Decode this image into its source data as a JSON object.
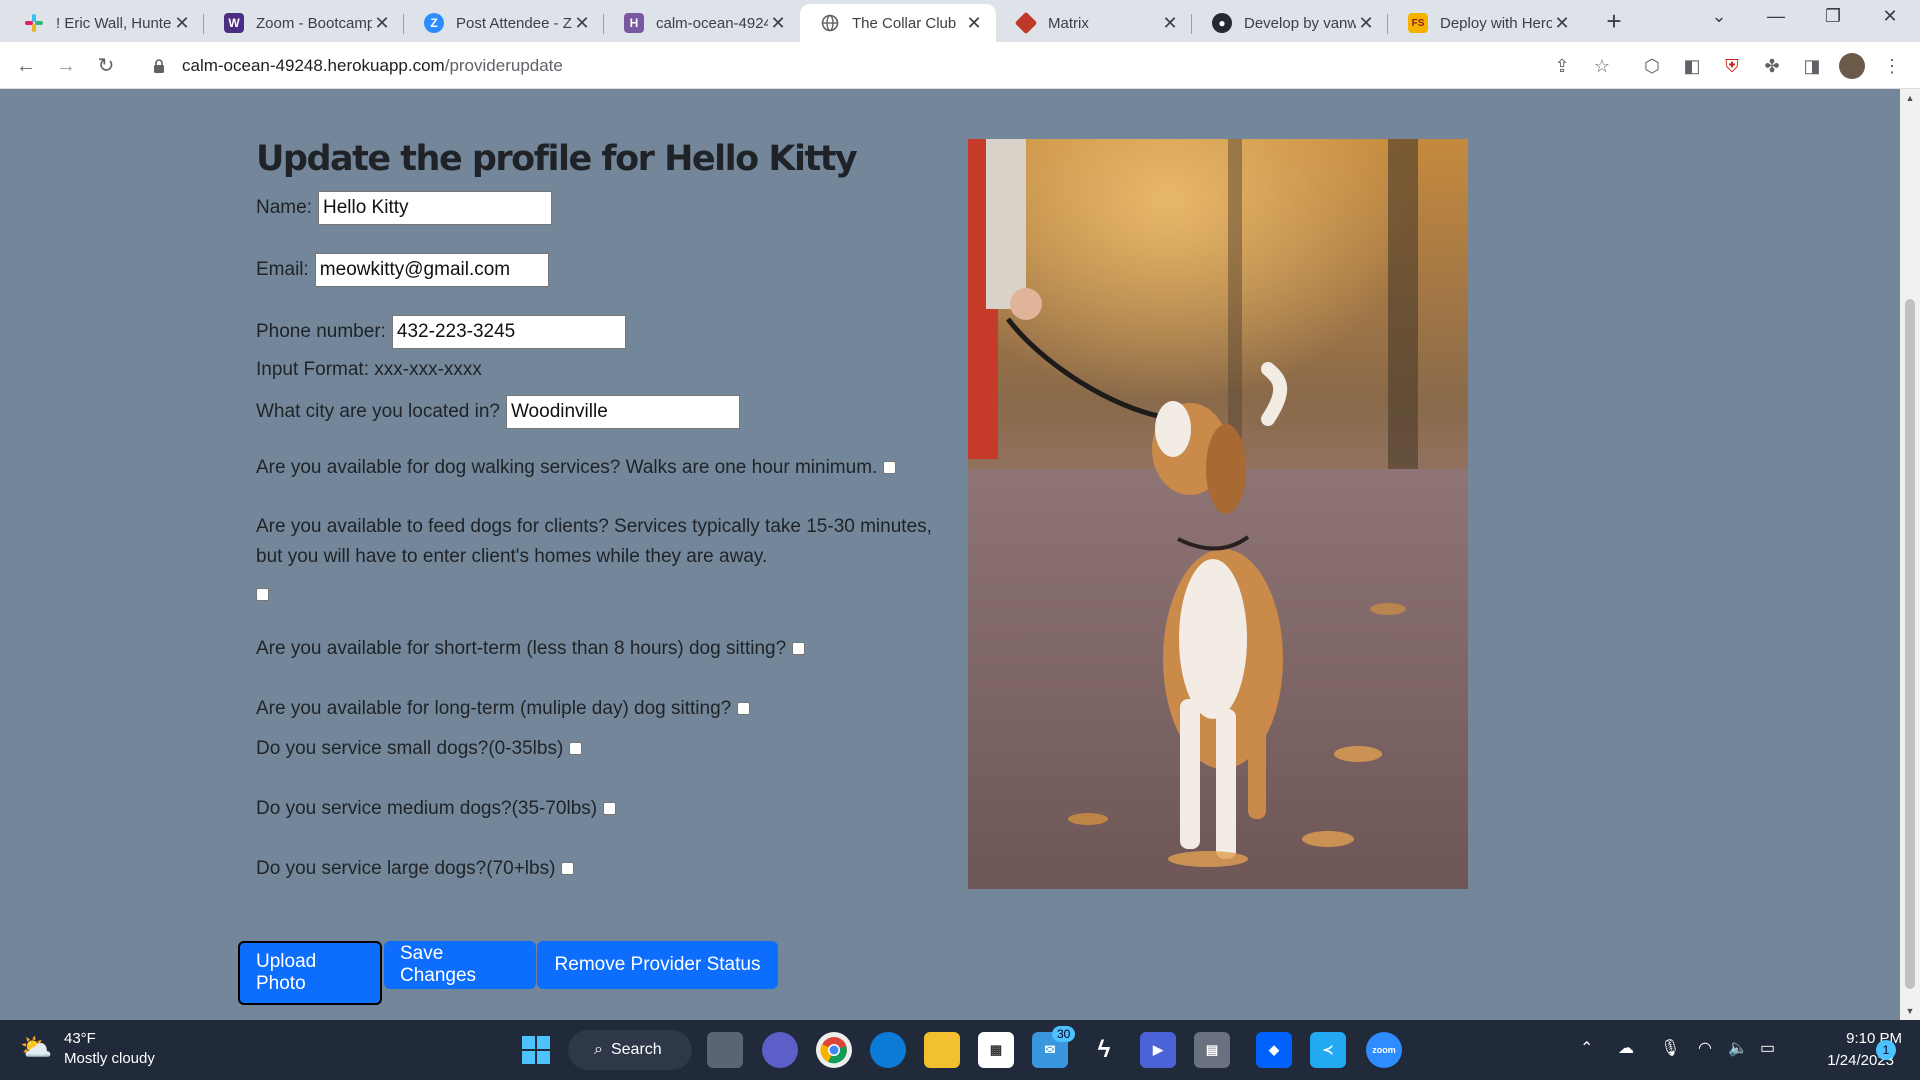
{
  "browser": {
    "tabs": [
      {
        "title": "! Eric Wall, Hunter",
        "active": false
      },
      {
        "title": "Zoom - Bootcamp",
        "active": false
      },
      {
        "title": "Post Attendee - Z",
        "active": false
      },
      {
        "title": "calm-ocean-4924",
        "active": false
      },
      {
        "title": "The Collar Club",
        "active": true
      },
      {
        "title": "Matrix",
        "active": false
      },
      {
        "title": "Develop by vanw",
        "active": false
      },
      {
        "title": "Deploy with Hero",
        "active": false
      }
    ],
    "url_host": "calm-ocean-49248.herokuapp.com",
    "url_path": "/providerupdate"
  },
  "page": {
    "title": "Update the profile for Hello Kitty",
    "name_label": "Name:",
    "name_value": "Hello Kitty",
    "email_label": "Email:",
    "email_value": "meowkitty@gmail.com",
    "phone_label": "Phone number:",
    "phone_value": "432-223-3245",
    "phone_format": "Input Format: xxx-xxx-xxxx",
    "city_label": "What city are you located in?",
    "city_value": "Woodinville",
    "q_walking": "Are you available for dog walking services? Walks are one hour minimum.",
    "q_feeding": "Are you available to feed dogs for clients? Services typically take 15-30 minutes, but you will have to enter client's homes while they are away.",
    "q_short_term": "Are you available for short-term (less than 8 hours) dog sitting?",
    "q_long_term": "Are you available for long-term (muliple day) dog sitting?",
    "q_small": "Do you service small dogs?(0-35lbs)",
    "q_medium": "Do you service medium dogs?(35-70lbs)",
    "q_large": "Do you service large dogs?(70+lbs)",
    "upload_label": "Upload Photo",
    "save_label": "Save Changes",
    "remove_label": "Remove Provider Status"
  },
  "taskbar": {
    "temperature": "43°F",
    "weather": "Mostly cloudy",
    "search_label": "Search",
    "mail_badge": "30",
    "time": "9:10 PM",
    "date": "1/24/2023",
    "notification_count": "1"
  },
  "colors": {
    "page_bg": "#74879a",
    "button_blue": "#0d6efd",
    "taskbar_bg": "#202a3a"
  }
}
